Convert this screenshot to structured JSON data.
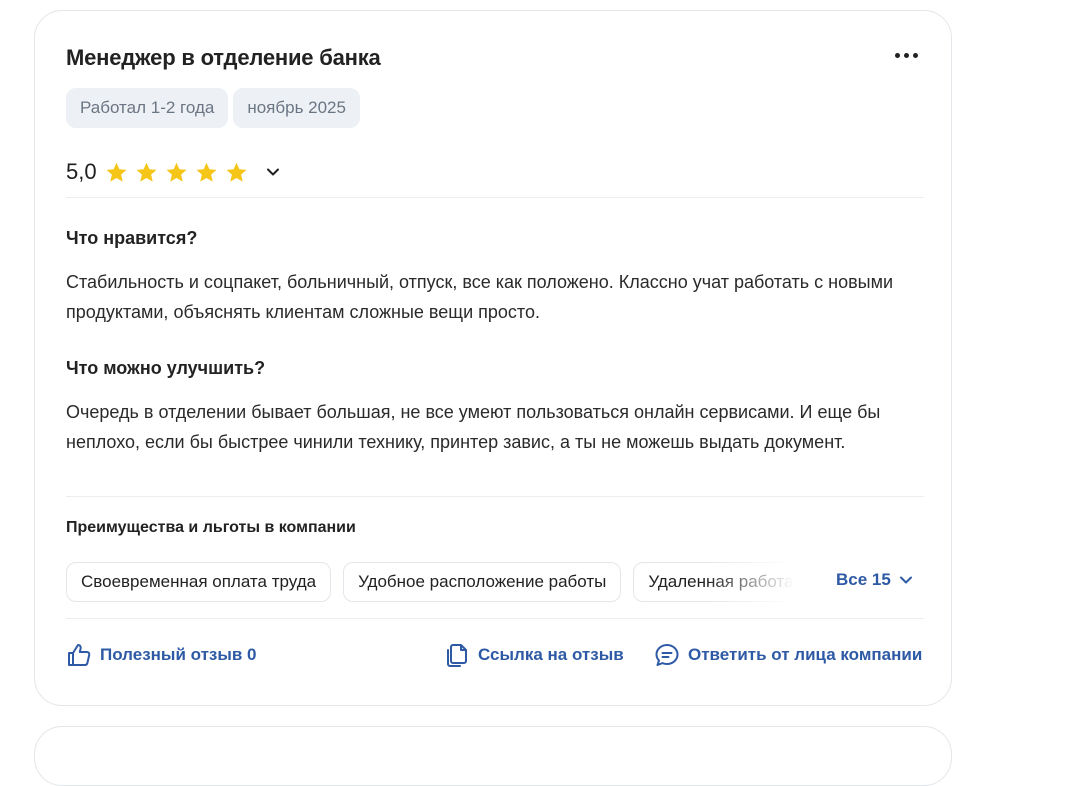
{
  "review": {
    "title": "Менеджер в отделение банка",
    "tags": [
      "Работал 1-2 года",
      "ноябрь 2025"
    ],
    "rating": "5,0",
    "stars": 5,
    "star_color": "#f5c518",
    "likes_title": "Что нравится?",
    "likes_text": "Стабильность и соцпакет, больничный, отпуск, все как положено. Классно учат работать с новыми продуктами, объяснять клиентам сложные вещи просто.",
    "improve_title": "Что можно улучшить?",
    "improve_text": "Очередь в отделении бывает большая, не все умеют пользоваться онлайн сервисами. И еще бы неплохо, если бы быстрее чинили технику, принтер завис, а ты не можешь выдать документ."
  },
  "benefits": {
    "title": "Преимущества и льготы в компании",
    "items": [
      "Своевременная оплата труда",
      "Удобное расположение работы",
      "Удаленная работа"
    ],
    "all_label": "Все 15"
  },
  "actions": {
    "useful_label": "Полезный отзыв 0",
    "link_label": "Ссылка на отзыв",
    "reply_label": "Ответить от лица компании"
  },
  "colors": {
    "accent": "#2e5aa5",
    "tag_bg": "#edf0f4"
  },
  "icons": {
    "more": "more-horizontal-icon",
    "chevron": "chevron-down-icon",
    "like": "thumbs-up-icon",
    "link": "copy-link-icon",
    "reply": "chat-bubble-icon"
  }
}
